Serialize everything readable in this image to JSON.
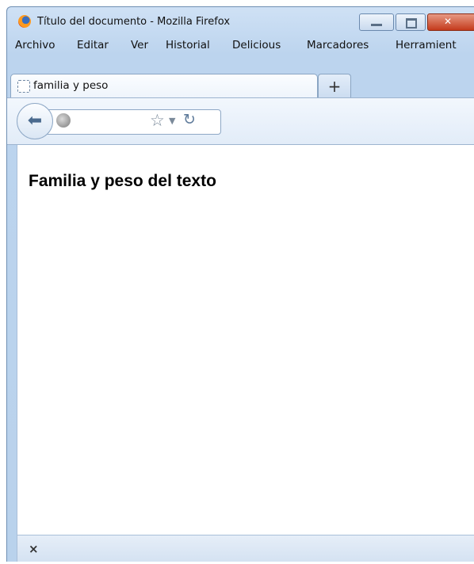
{
  "window": {
    "title": "Título del documento - Mozilla Firefox"
  },
  "menu": [
    "Archivo",
    "Editar",
    "Ver",
    "Historial",
    "Delicious",
    "Marcadores",
    "Herramient"
  ],
  "tab": {
    "title": "familia y peso",
    "new_tab_label": "+"
  },
  "page": {
    "heading": "Familia y peso del texto"
  },
  "statusbar": {
    "close_glyph": "×"
  },
  "icons": {
    "minimize": "minimize-icon",
    "maximize": "maximize-icon",
    "close": "close-icon",
    "back": "back-arrow-icon",
    "site": "globe-icon",
    "bookmark": "star-icon",
    "history": "dropdown-icon",
    "reload": "reload-icon"
  },
  "colors": {
    "chrome": "#bcd4ee",
    "close": "#c43a1c",
    "content": "#ffffff"
  }
}
